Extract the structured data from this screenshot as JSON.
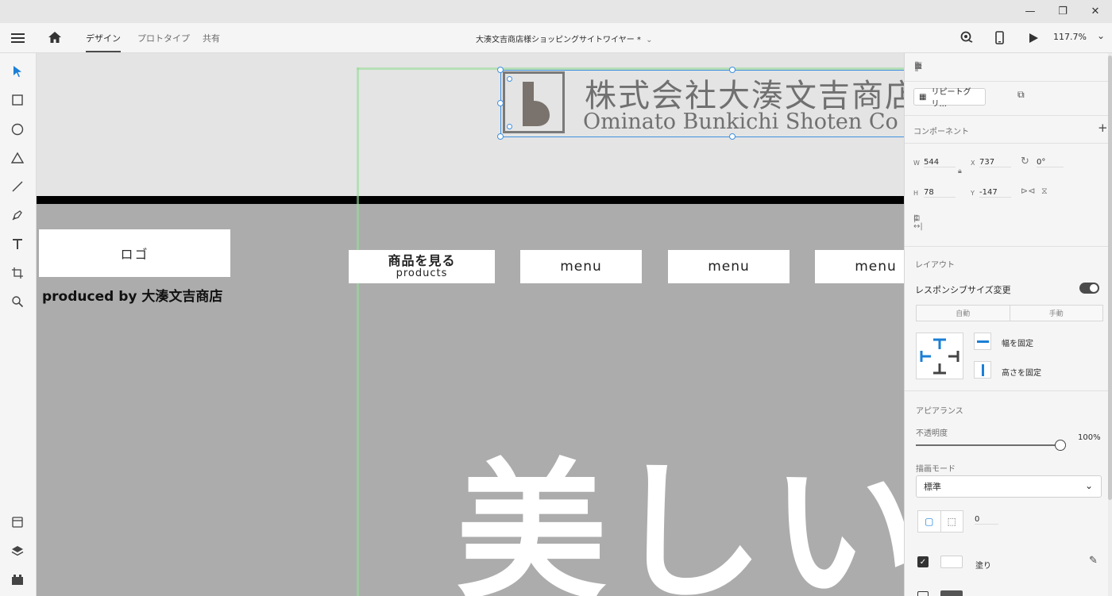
{
  "window": {
    "minimize": "—",
    "restore": "❐",
    "close": "✕"
  },
  "toolbar": {
    "tabs": [
      "デザイン",
      "プロトタイプ",
      "共有"
    ],
    "document_title": "大湊文吉商店様ショッピングサイトワイヤー *",
    "zoom": "117.7%"
  },
  "canvas": {
    "logo_placeholder": "ロゴ",
    "produced_by": "produced by 大湊文吉商店",
    "nav": {
      "primary_main": "商品を見る",
      "primary_sub": "products",
      "menu_items": [
        "menu",
        "menu",
        "menu"
      ]
    },
    "hero_text": "美しい石",
    "company_logo": {
      "jp": "株式会社大湊文吉商店",
      "en": "Ominato Bunkichi Shoten Co"
    }
  },
  "panel": {
    "repeat_grid": "リピートグリ...",
    "component_label": "コンポーネント",
    "w_label": "W",
    "w": "544",
    "h_label": "H",
    "h": "78",
    "x_label": "X",
    "x": "737",
    "y_label": "Y",
    "y": "-147",
    "rotation": "0°",
    "layout_label": "レイアウト",
    "responsive_label": "レスポンシブサイズ変更",
    "auto_label": "自動",
    "manual_label": "手動",
    "fix_width": "幅を固定",
    "fix_height": "高さを固定",
    "appearance_label": "アピアランス",
    "opacity_label": "不透明度",
    "opacity_value": "100%",
    "blend_label": "描画モード",
    "blend_value": "標準",
    "corner_value": "0",
    "fill_label": "塗り"
  },
  "colors": {
    "accent": "#1b7fd6",
    "artboard": "#acacac",
    "selection": "#3f90e0"
  }
}
